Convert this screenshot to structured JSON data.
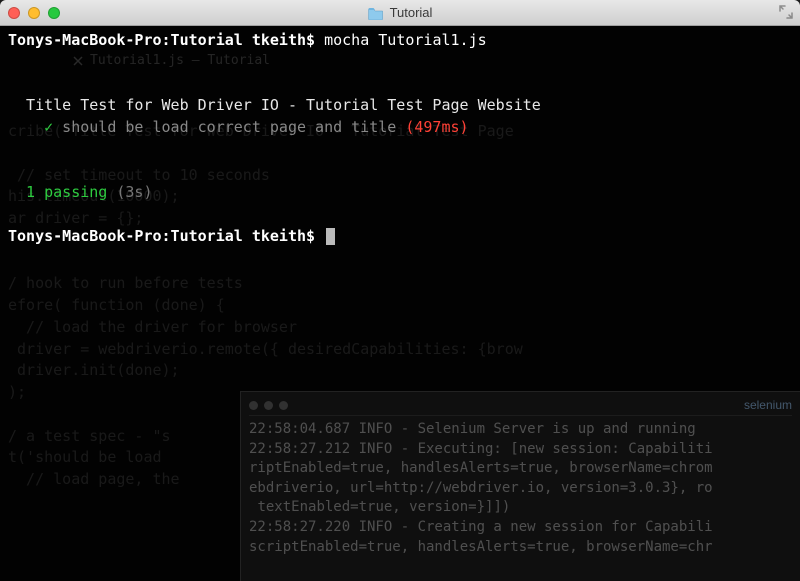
{
  "window": {
    "title": "Tutorial"
  },
  "terminal": {
    "prompt1": "Tonys-MacBook-Pro:Tutorial tkeith$",
    "command": "mocha Tutorial1.js",
    "test_title": "Title Test for Web Driver IO - Tutorial Test Page Website",
    "check": "✓",
    "test_pass": "should be load correct page and title",
    "timing": "(497ms)",
    "summary_pass": "1 passing",
    "summary_dur": "(3s)",
    "prompt2": "Tonys-MacBook-Pro:Tutorial tkeith$"
  },
  "ghost": {
    "tab_label": "Tutorial1.js — Tutorial",
    "code": "\n\n\n\ncribe('Title Test for Web Driver IO - Tutorial Test Page\n\n // set timeout to 10 seconds\nhis.timeout(10000);\nar driver = {};\n\n\n/ hook to run before tests\nefore( function (done) {\n  // load the driver for browser\n driver = webdriverio.remote({ desiredCapabilities: {brow\n driver.init(done);\n);\n\n/ a test spec - \"s\nt('should be load\n  // load page, the"
  },
  "selenium": {
    "title": "selenium",
    "log": "22:58:04.687 INFO - Selenium Server is up and running\n22:58:27.212 INFO - Executing: [new session: Capabiliti\nriptEnabled=true, handlesAlerts=true, browserName=chrom\nebdriverio, url=http://webdriver.io, version=3.0.3}, ro\n textEnabled=true, version=}]])\n22:58:27.220 INFO - Creating a new session for Capabili\nscriptEnabled=true, handlesAlerts=true, browserName=chr"
  }
}
